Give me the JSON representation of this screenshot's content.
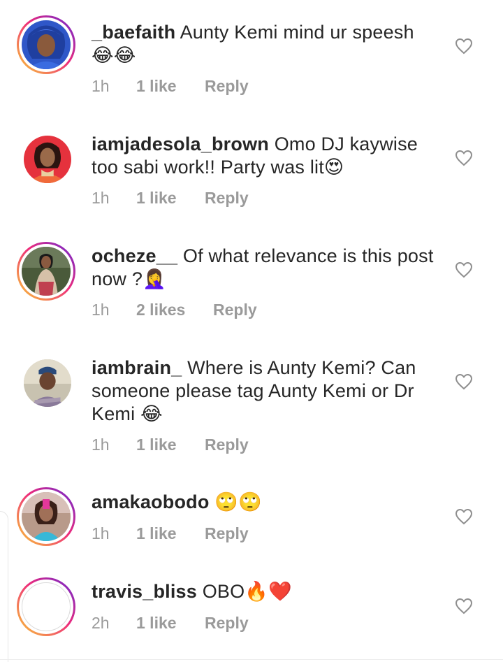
{
  "comments": [
    {
      "username": "_baefaith",
      "text": "Aunty Kemi mind ur speesh",
      "text_line2": "",
      "emoji": "😂😂",
      "time": "1h",
      "likes": "1 like",
      "reply": "Reply"
    },
    {
      "username": "iamjadesola_brown",
      "text": "Omo DJ kaywise",
      "text_line2": "too sabi work!! Party was lit",
      "emoji": "😍",
      "time": "1h",
      "likes": "1 like",
      "reply": "Reply"
    },
    {
      "username": "ocheze__",
      "text": "Of what relevance is this post",
      "text_line2": "now ?",
      "emoji": "🤦‍♀️",
      "time": "1h",
      "likes": "2 likes",
      "reply": "Reply"
    },
    {
      "username": "iambrain_",
      "text": "Where is Aunty Kemi? Can",
      "text_line2": "someone please tag Aunty Kemi or Dr",
      "text_line3": "Kemi",
      "emoji": "😂",
      "time": "1h",
      "likes": "1 like",
      "reply": "Reply"
    },
    {
      "username": "amakaobodo",
      "text": "",
      "emoji": "🙄🙄",
      "time": "1h",
      "likes": "1 like",
      "reply": "Reply"
    },
    {
      "username": "travis_bliss",
      "text": "OBO",
      "emoji": "🔥❤️",
      "time": "2h",
      "likes": "1 like",
      "reply": "Reply"
    }
  ],
  "icons": {
    "like": "heart-outline-icon"
  },
  "colors": {
    "text": "#262626",
    "meta": "#9a9a9a",
    "story_ring": [
      "#f9ce34",
      "#ee2a7b",
      "#6228d7"
    ]
  }
}
